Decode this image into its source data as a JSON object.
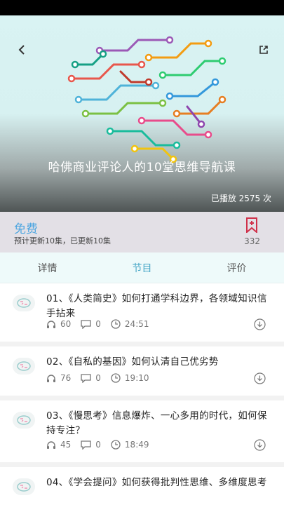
{
  "hero": {
    "title": "哈佛商业评论人的10堂思维导航课",
    "play_count": "已播放 2575 次"
  },
  "price_bar": {
    "price": "免费",
    "update_info": "预计更新10集，已更新10集",
    "favorite_count": "332"
  },
  "tabs": [
    {
      "label": "详情",
      "active": false
    },
    {
      "label": "节目",
      "active": true
    },
    {
      "label": "评价",
      "active": false
    }
  ],
  "episodes": [
    {
      "title": "01、《人类简史》如何打通学科边界，各领域知识信手拈来",
      "plays": "60",
      "comments": "0",
      "duration": "24:51"
    },
    {
      "title": "02、《自私的基因》如何认清自己优劣势",
      "plays": "76",
      "comments": "0",
      "duration": "19:10"
    },
    {
      "title": "03、《慢思考》信息爆炸、一心多用的时代，如何保持专注？",
      "plays": "45",
      "comments": "0",
      "duration": "18:49"
    },
    {
      "title": "04、《学会提问》如何获得批判性思维、多维度思考",
      "plays": "",
      "comments": "",
      "duration": ""
    }
  ],
  "colors": {
    "accent": "#45a6c6",
    "price": "#4ea6e0",
    "bookmark": "#d0304a"
  },
  "icons": {
    "back": "back-arrow-icon",
    "share": "share-icon",
    "favorite": "bookmark-plus-icon",
    "plays": "headphones-icon",
    "comments": "comment-icon",
    "duration": "clock-icon",
    "download": "download-icon"
  }
}
